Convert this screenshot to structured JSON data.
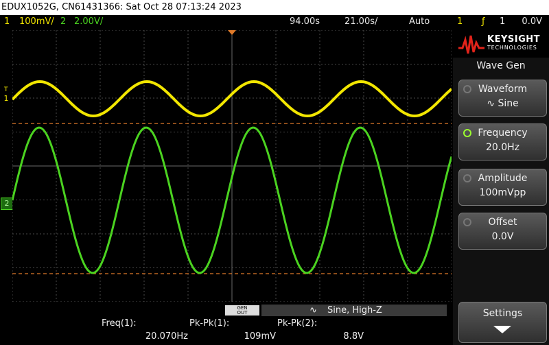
{
  "title_bar": {
    "text": "EDUX1052G, CN61431366: Sat Oct 28 07:13:24 2023"
  },
  "status": {
    "ch1_num": "1",
    "ch1_scale": "100mV/",
    "ch2_num": "2",
    "ch2_scale": "2.00V/",
    "time_delay": "94.00s",
    "time_scale": "21.00s/",
    "trigger_mode": "Auto",
    "trigger_source": "1",
    "trigger_level": "0.0V"
  },
  "markers": {
    "ch1": "1",
    "ch2": "2",
    "trig": "T"
  },
  "panel": {
    "brand": "KEYSIGHT",
    "brand_sub": "TECHNOLOGIES",
    "title": "Wave Gen",
    "softkeys": [
      {
        "label": "Waveform",
        "value": "Sine"
      },
      {
        "label": "Frequency",
        "value": "20.0Hz"
      },
      {
        "label": "Amplitude",
        "value": "100mVpp"
      },
      {
        "label": "Offset",
        "value": "0.0V"
      },
      {
        "label": "Settings",
        "value": ""
      }
    ]
  },
  "gen_bar": {
    "gen_label_top": "GEN",
    "gen_label_bottom": "OUT",
    "text": "Sine, High-Z"
  },
  "measurements": [
    {
      "label": "Freq(1):",
      "value": "20.070Hz"
    },
    {
      "label": "Pk-Pk(1):",
      "value": "109mV"
    },
    {
      "label": "Pk-Pk(2):",
      "value": "8.8V"
    }
  ],
  "colors": {
    "ch1": "#f2e600",
    "ch2": "#4bd320",
    "grid": "#4a4a4a",
    "cursor": "#e07a2a"
  }
}
